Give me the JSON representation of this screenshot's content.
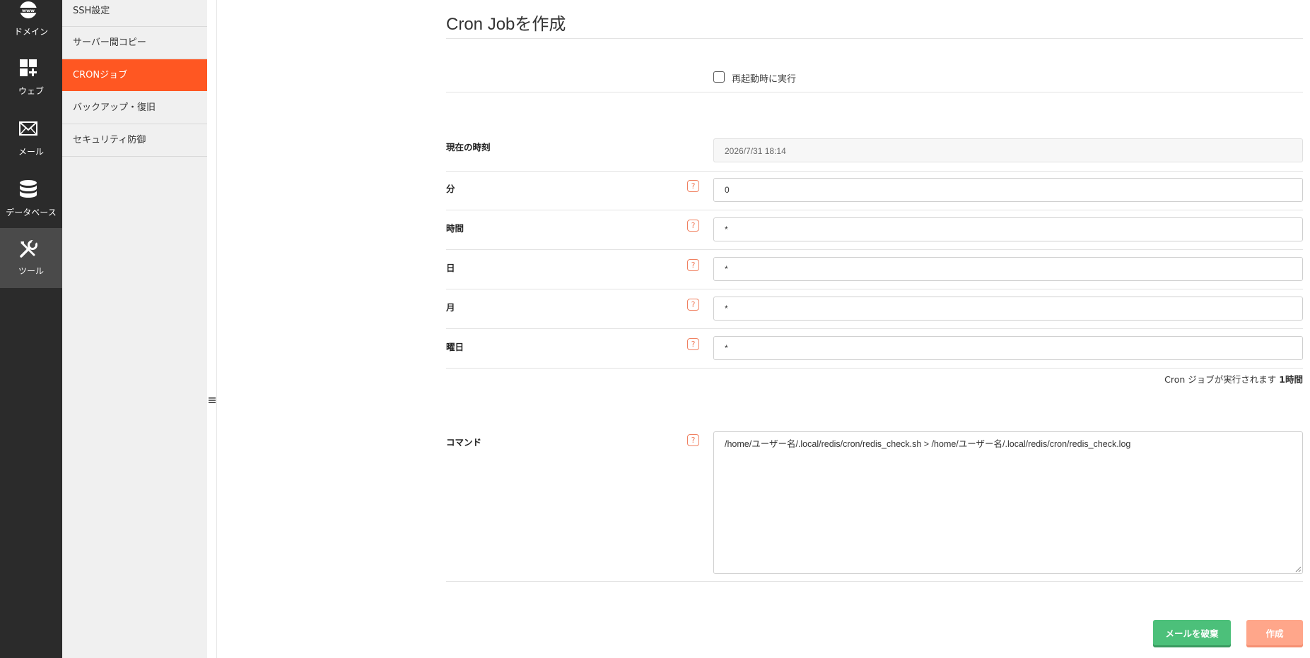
{
  "rail": {
    "items": [
      {
        "label": "ドメイン",
        "icon": "www-globe-icon"
      },
      {
        "label": "ウェブ",
        "icon": "web-grid-icon"
      },
      {
        "label": "メール",
        "icon": "mail-icon"
      },
      {
        "label": "データベース",
        "icon": "database-icon"
      },
      {
        "label": "ツール",
        "icon": "tools-icon",
        "active": true
      }
    ]
  },
  "submenu": {
    "items": [
      {
        "label": "SSH設定"
      },
      {
        "label": "サーバー間コピー"
      },
      {
        "label": "CRONジョブ",
        "active": true
      },
      {
        "label": "バックアップ・復旧"
      },
      {
        "label": "セキュリティ防御"
      }
    ]
  },
  "form": {
    "title": "Cron Jobを作成",
    "reboot_label": "再起動時に実行",
    "current_time": {
      "label": "現在の時刻",
      "value": "2026/7/31 18:14"
    },
    "minute": {
      "label": "分",
      "value": "0"
    },
    "hour": {
      "label": "時間",
      "value": "*"
    },
    "day": {
      "label": "日",
      "value": "*"
    },
    "month": {
      "label": "月",
      "value": "*"
    },
    "weekday": {
      "label": "曜日",
      "value": "*"
    },
    "summary_prefix": "Cron ジョブが実行されます",
    "summary_value": "1時間",
    "command": {
      "label": "コマンド",
      "value": "/home/ユーザー名/.local/redis/cron/redis_check.sh > /home/ユーザー名/.local/redis/cron/redis_check.log"
    },
    "help_symbol": "?"
  },
  "buttons": {
    "discard_mail": "メールを破棄",
    "create": "作成"
  },
  "colors": {
    "accent": "#ff5722",
    "green": "#4cc07a",
    "create_disabled": "#ffa68a",
    "rail_bg": "#2b2b2b"
  }
}
